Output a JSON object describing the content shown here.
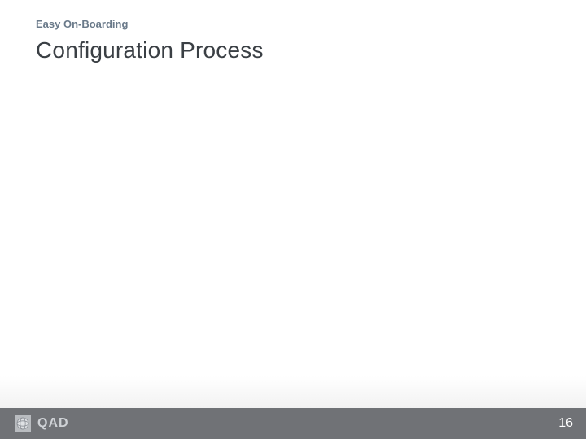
{
  "kicker": "Easy On-Boarding",
  "title": "Configuration Process",
  "brand": "QAD",
  "page_number": "16"
}
